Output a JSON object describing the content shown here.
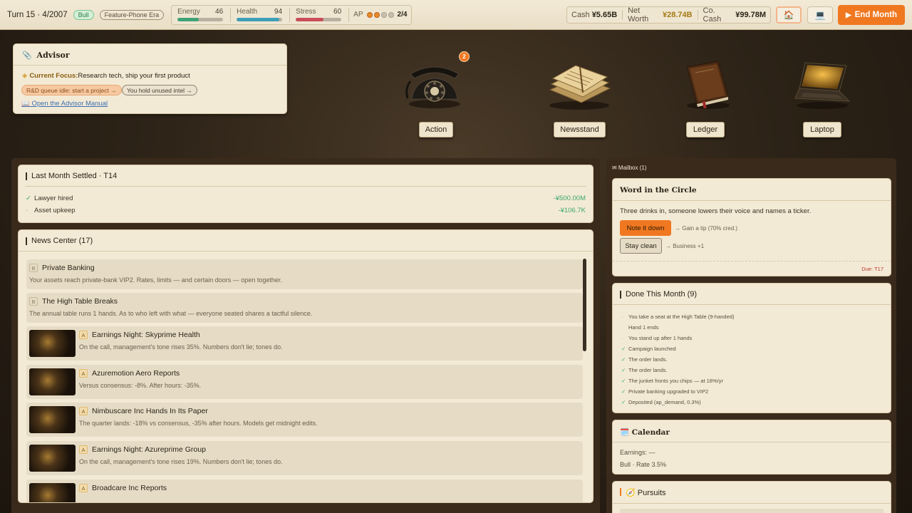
{
  "topbar": {
    "turn": "Turn 15 · 4/2007",
    "market": "Bull",
    "era": "Feature-Phone Era",
    "stats": [
      {
        "label": "Energy",
        "value": "46",
        "level": 46,
        "color": "#3fa276"
      },
      {
        "label": "Health",
        "value": "94",
        "level": 94,
        "color": "#3d9fb8"
      },
      {
        "label": "Stress",
        "value": "60",
        "level": 60,
        "color": "#c94d5a"
      }
    ],
    "ap_label": "AP",
    "ap_filled": 2,
    "ap_total": 4,
    "ap_count": "2/4",
    "cash_label": "Cash",
    "cash": "¥5.65B",
    "networth_label": "Net Worth",
    "networth": "¥28.74B",
    "cocash_label": "Co. Cash",
    "cocash": "¥99.78M",
    "home_icon": "🏠",
    "laptop_icon": "💻",
    "end_month": "End Month",
    "end_icon": "▶"
  },
  "advisor": {
    "title": "Advisor",
    "clip_icon": "📎",
    "focus_label": "Current Focus:",
    "focus_text": "Research tech, ship your first product",
    "chip_warn": "R&D queue idle: start a project →",
    "chip_info": "You hold unused intel →",
    "manual_icon": "📖",
    "manual": "Open the Advisor Manual"
  },
  "scene": {
    "action": "Action",
    "action_badge": "2",
    "newsstand": "Newsstand",
    "ledger": "Ledger",
    "laptop": "Laptop"
  },
  "settled": {
    "title": "Last Month Settled · T14",
    "rows": [
      {
        "mark": "✓",
        "label": "Lawyer hired",
        "amount": "-¥500.00M"
      },
      {
        "mark": "·",
        "label": "Asset upkeep",
        "amount": "-¥106.7K"
      }
    ]
  },
  "news": {
    "title": "News Center (17)",
    "items": [
      {
        "tag": "B",
        "title": "Private Banking",
        "desc": "Your assets reach private-bank VIP2. Rates, limits — and certain doors — open together."
      },
      {
        "tag": "B",
        "title": "The High Table Breaks",
        "desc": "The annual table runs 1 hands. As to who left with what — everyone seated shares a tactful silence."
      },
      {
        "tag": "A",
        "title": "Earnings Night: Skyprime Health",
        "desc": "On the call, management's tone rises 35%. Numbers don't lie; tones do."
      },
      {
        "tag": "A",
        "title": "Azuremotion Aero Reports",
        "desc": "Versus consensus: -8%. After hours: -35%."
      },
      {
        "tag": "A",
        "title": "Nimbuscare Inc Hands In Its Paper",
        "desc": "The quarter lands: -18% vs consensus, -35% after hours. Models get midnight edits."
      },
      {
        "tag": "A",
        "title": "Earnings Night: Azureprime Group",
        "desc": "On the call, management's tone rises 19%. Numbers don't lie; tones do."
      },
      {
        "tag": "A",
        "title": "Broadcare Inc Reports",
        "desc": ""
      }
    ]
  },
  "mailbox": {
    "header": "✉ Mailbox (1)",
    "title": "Word in the Circle",
    "body": "Three drinks in, someone lowers their voice and names a ticker.",
    "primary": "Note it down",
    "primary_hint": "→ Gain a tip (70% cred.)",
    "secondary": "Stay clean",
    "secondary_hint": "→ Business +1",
    "due": "Due: T17"
  },
  "done": {
    "title": "Done This Month (9)",
    "rows": [
      {
        "mark": "·",
        "text": "You take a seat at the High Table (9-handed)"
      },
      {
        "mark": "·",
        "text": "Hand 1 ends"
      },
      {
        "mark": "·",
        "text": "You stand up after 1 hands"
      },
      {
        "mark": "✓",
        "text": "Campaign launched"
      },
      {
        "mark": "✓",
        "text": "The order lands."
      },
      {
        "mark": "✓",
        "text": "The order lands."
      },
      {
        "mark": "✓",
        "text": "The junket fronts you chips — at 18%/yr"
      },
      {
        "mark": "✓",
        "text": "Private banking upgraded to VIP2"
      },
      {
        "mark": "✓",
        "text": "Deposited (ap_demand, 0.3%)"
      }
    ]
  },
  "calendar": {
    "icon": "🗓️",
    "title": "Calendar",
    "earnings": "Earnings: —",
    "market": "Bull · Rate 3.5%"
  },
  "pursuits": {
    "icon": "🧭",
    "title": "Pursuits"
  }
}
